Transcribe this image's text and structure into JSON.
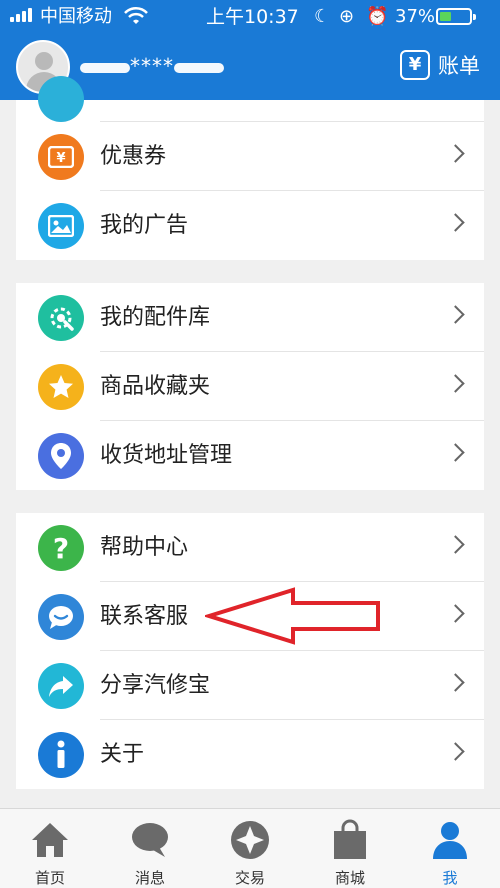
{
  "status_bar": {
    "carrier": "中国移动",
    "time": "上午10:37",
    "battery_percent": "37%",
    "battery_level": 0.37
  },
  "profile": {
    "username": "****",
    "bill_icon": "¥",
    "bill_label": "账单"
  },
  "groups": [
    {
      "items": [
        {
          "label": "优惠券",
          "icon": "coupon-icon",
          "color": "#f07a1e"
        },
        {
          "label": "我的广告",
          "icon": "picture-icon",
          "color": "#1fa8e6"
        }
      ]
    },
    {
      "items": [
        {
          "label": "我的配件库",
          "icon": "gear-wrench-icon",
          "color": "#1fbf9f"
        },
        {
          "label": "商品收藏夹",
          "icon": "star-icon",
          "color": "#f5b21b"
        },
        {
          "label": "收货地址管理",
          "icon": "location-pin-icon",
          "color": "#4a6fe0"
        }
      ]
    },
    {
      "items": [
        {
          "label": "帮助中心",
          "icon": "question-icon",
          "color": "#3cb54a"
        },
        {
          "label": "联系客服",
          "icon": "chat-bubble-icon",
          "color": "#2f86d8"
        },
        {
          "label": "分享汽修宝",
          "icon": "share-arrow-icon",
          "color": "#22b7d6"
        },
        {
          "label": "关于",
          "icon": "info-icon",
          "color": "#1a7ad6"
        }
      ]
    }
  ],
  "tabbar": {
    "tabs": [
      {
        "label": "首页",
        "icon": "home-icon"
      },
      {
        "label": "消息",
        "icon": "message-icon"
      },
      {
        "label": "交易",
        "icon": "compass-icon"
      },
      {
        "label": "商城",
        "icon": "shopping-bag-icon"
      },
      {
        "label": "我",
        "icon": "user-icon"
      }
    ],
    "active_tab": "我"
  },
  "colors": {
    "header": "#1a7ad6",
    "annotation_arrow": "#e0242a"
  }
}
